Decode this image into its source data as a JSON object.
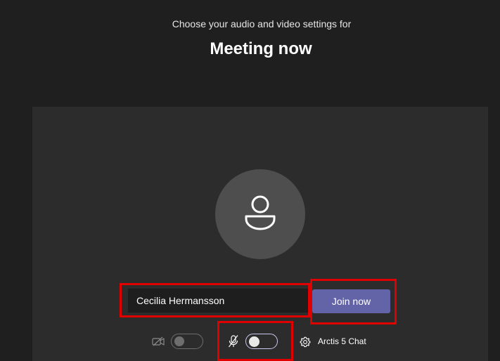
{
  "header": {
    "subtitle": "Choose your audio and video settings for",
    "title": "Meeting now"
  },
  "join": {
    "name_value": "Cecilia Hermansson",
    "join_label": "Join now"
  },
  "controls": {
    "camera_icon": "video-off-icon",
    "camera_state": "off",
    "mic_icon": "mic-off-icon",
    "mic_state": "off",
    "settings_icon": "gear-icon",
    "device_label": "Arctis 5 Chat"
  },
  "colors": {
    "background": "#1f1f1f",
    "preview": "#2d2c2c",
    "avatar": "#4e4e4e",
    "accent": "#6264a7",
    "highlight": "#e00000"
  }
}
